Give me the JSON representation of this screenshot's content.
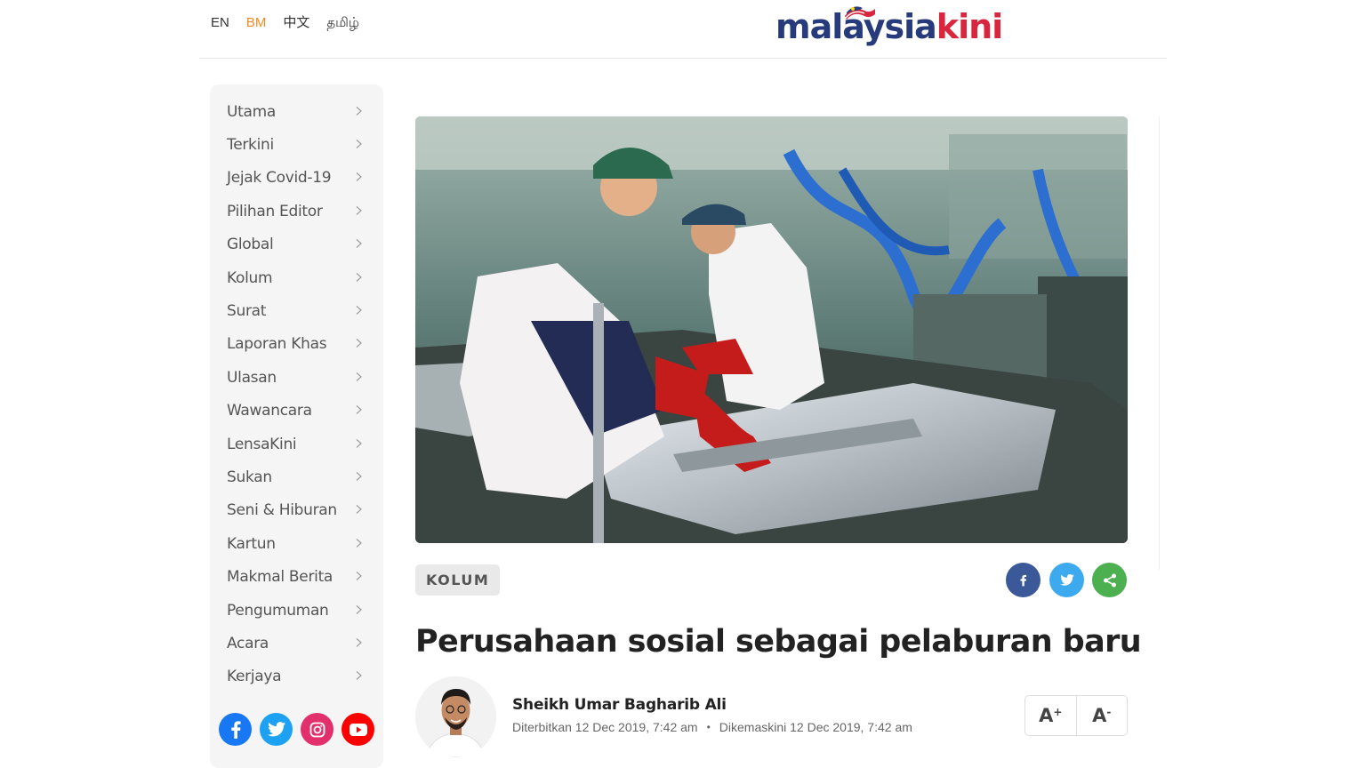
{
  "header": {
    "languages": [
      {
        "label": "EN",
        "active": false
      },
      {
        "label": "BM",
        "active": true
      },
      {
        "label": "中文",
        "active": false
      },
      {
        "label": "தமிழ்",
        "active": false
      }
    ],
    "logo_part1": "malaysia",
    "logo_part2": "kini",
    "colors": {
      "accent": "#f08a24",
      "brand_blue": "#273a7c",
      "brand_red": "#d7263d"
    }
  },
  "sidebar": {
    "items": [
      {
        "label": "Utama"
      },
      {
        "label": "Terkini"
      },
      {
        "label": "Jejak Covid-19"
      },
      {
        "label": "Pilihan Editor"
      },
      {
        "label": "Global"
      },
      {
        "label": "Kolum"
      },
      {
        "label": "Surat"
      },
      {
        "label": "Laporan Khas"
      },
      {
        "label": "Ulasan"
      },
      {
        "label": "Wawancara"
      },
      {
        "label": "LensaKini"
      },
      {
        "label": "Sukan"
      },
      {
        "label": "Seni & Hiburan"
      },
      {
        "label": "Kartun"
      },
      {
        "label": "Makmal Berita"
      },
      {
        "label": "Pengumuman"
      },
      {
        "label": "Acara"
      },
      {
        "label": "Kerjaya"
      }
    ],
    "socials": [
      {
        "icon": "facebook-icon",
        "color": "#1877f2"
      },
      {
        "icon": "twitter-icon",
        "color": "#1da1f2"
      },
      {
        "icon": "instagram-icon",
        "color": "#e1306c"
      },
      {
        "icon": "youtube-icon",
        "color": "#ff0000"
      }
    ]
  },
  "article": {
    "category": "KOLUM",
    "title": "Perusahaan sosial sebagai pelaburan baru",
    "author": "Sheikh Umar Bagharib Ali",
    "published": "Diterbitkan 12 Dec 2019, 7:42 am",
    "separator": "•",
    "updated": "Dikemaskini 12 Dec 2019, 7:42 am",
    "share": [
      {
        "icon": "facebook-icon",
        "color": "#3b5998"
      },
      {
        "icon": "twitter-icon",
        "color": "#3daaf0"
      },
      {
        "icon": "share-icon",
        "color": "#4caf50"
      }
    ],
    "font_increase": "A",
    "font_increase_sign": "+",
    "font_decrease": "A",
    "font_decrease_sign": "-"
  }
}
